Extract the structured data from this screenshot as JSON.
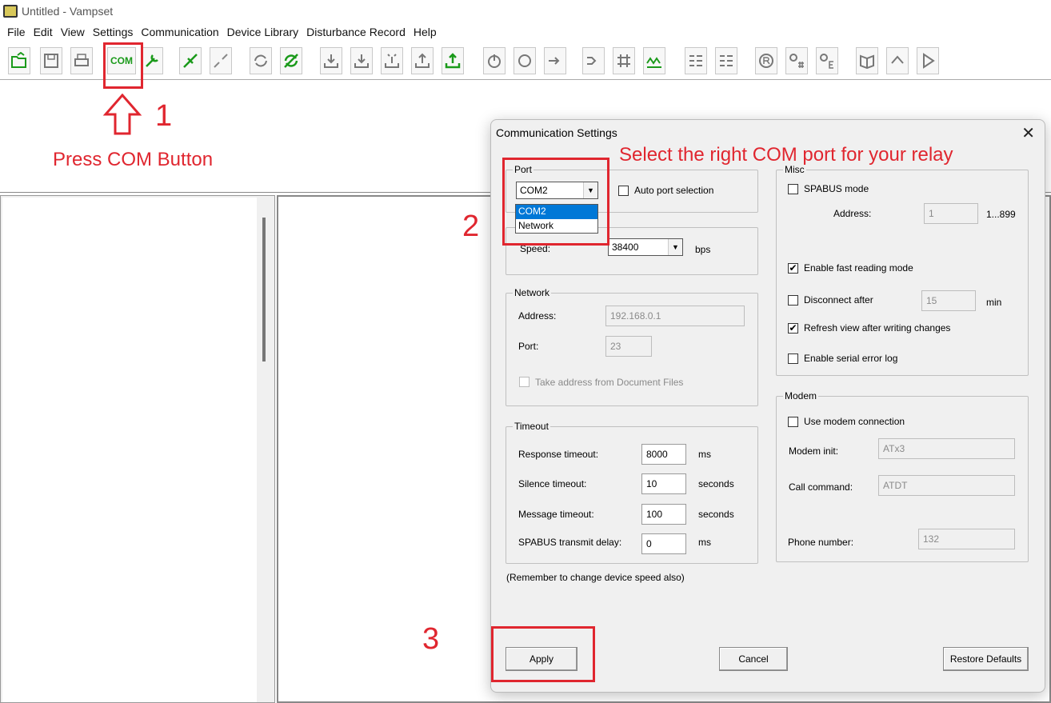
{
  "window": {
    "title": "Untitled - Vampset"
  },
  "menu": [
    "File",
    "Edit",
    "View",
    "Settings",
    "Communication",
    "Device Library",
    "Disturbance Record",
    "Help"
  ],
  "toolbar": {
    "com_label": "COM"
  },
  "annotations": {
    "step1_number": "1",
    "step1_text": "Press COM Button",
    "step2_number": "2",
    "step2_text": "Select the right COM port for your relay",
    "step3_number": "3",
    "color": "#e0262f"
  },
  "dialog": {
    "title": "Communication Settings",
    "port": {
      "group": "Port",
      "selected": "COM2",
      "options": [
        "COM2",
        "Network"
      ],
      "auto_port_label": "Auto port selection",
      "speed_label": "Speed:",
      "speed_value": "38400",
      "speed_unit": "bps"
    },
    "network": {
      "group": "Network",
      "address_label": "Address:",
      "address_value": "192.168.0.1",
      "port_label": "Port:",
      "port_value": "23",
      "take_address_label": "Take address from Document Files"
    },
    "timeout": {
      "group": "Timeout",
      "response_label": "Response timeout:",
      "response_value": "8000",
      "response_unit": "ms",
      "silence_label": "Silence timeout:",
      "silence_value": "10",
      "silence_unit": "seconds",
      "message_label": "Message timeout:",
      "message_value": "100",
      "message_unit": "seconds",
      "spabus_label": "SPABUS transmit delay:",
      "spabus_value": "0",
      "spabus_unit": "ms"
    },
    "note": "(Remember to change device speed also)",
    "misc": {
      "group": "Misc",
      "spabus_mode_label": "SPABUS mode",
      "address_label": "Address:",
      "address_value": "1",
      "address_range": "1...899",
      "fast_reading_label": "Enable fast reading mode",
      "disconnect_label": "Disconnect after",
      "disconnect_value": "15",
      "disconnect_unit": "min",
      "refresh_label": "Refresh view after writing changes",
      "serial_log_label": "Enable serial error log"
    },
    "modem": {
      "group": "Modem",
      "use_modem_label": "Use modem connection",
      "init_label": "Modem init:",
      "init_value": "ATx3",
      "call_label": "Call command:",
      "call_value": "ATDT",
      "phone_label": "Phone number:",
      "phone_value": "132"
    },
    "buttons": {
      "apply": "Apply",
      "cancel": "Cancel",
      "restore": "Restore Defaults"
    },
    "check_mark": "✔"
  }
}
